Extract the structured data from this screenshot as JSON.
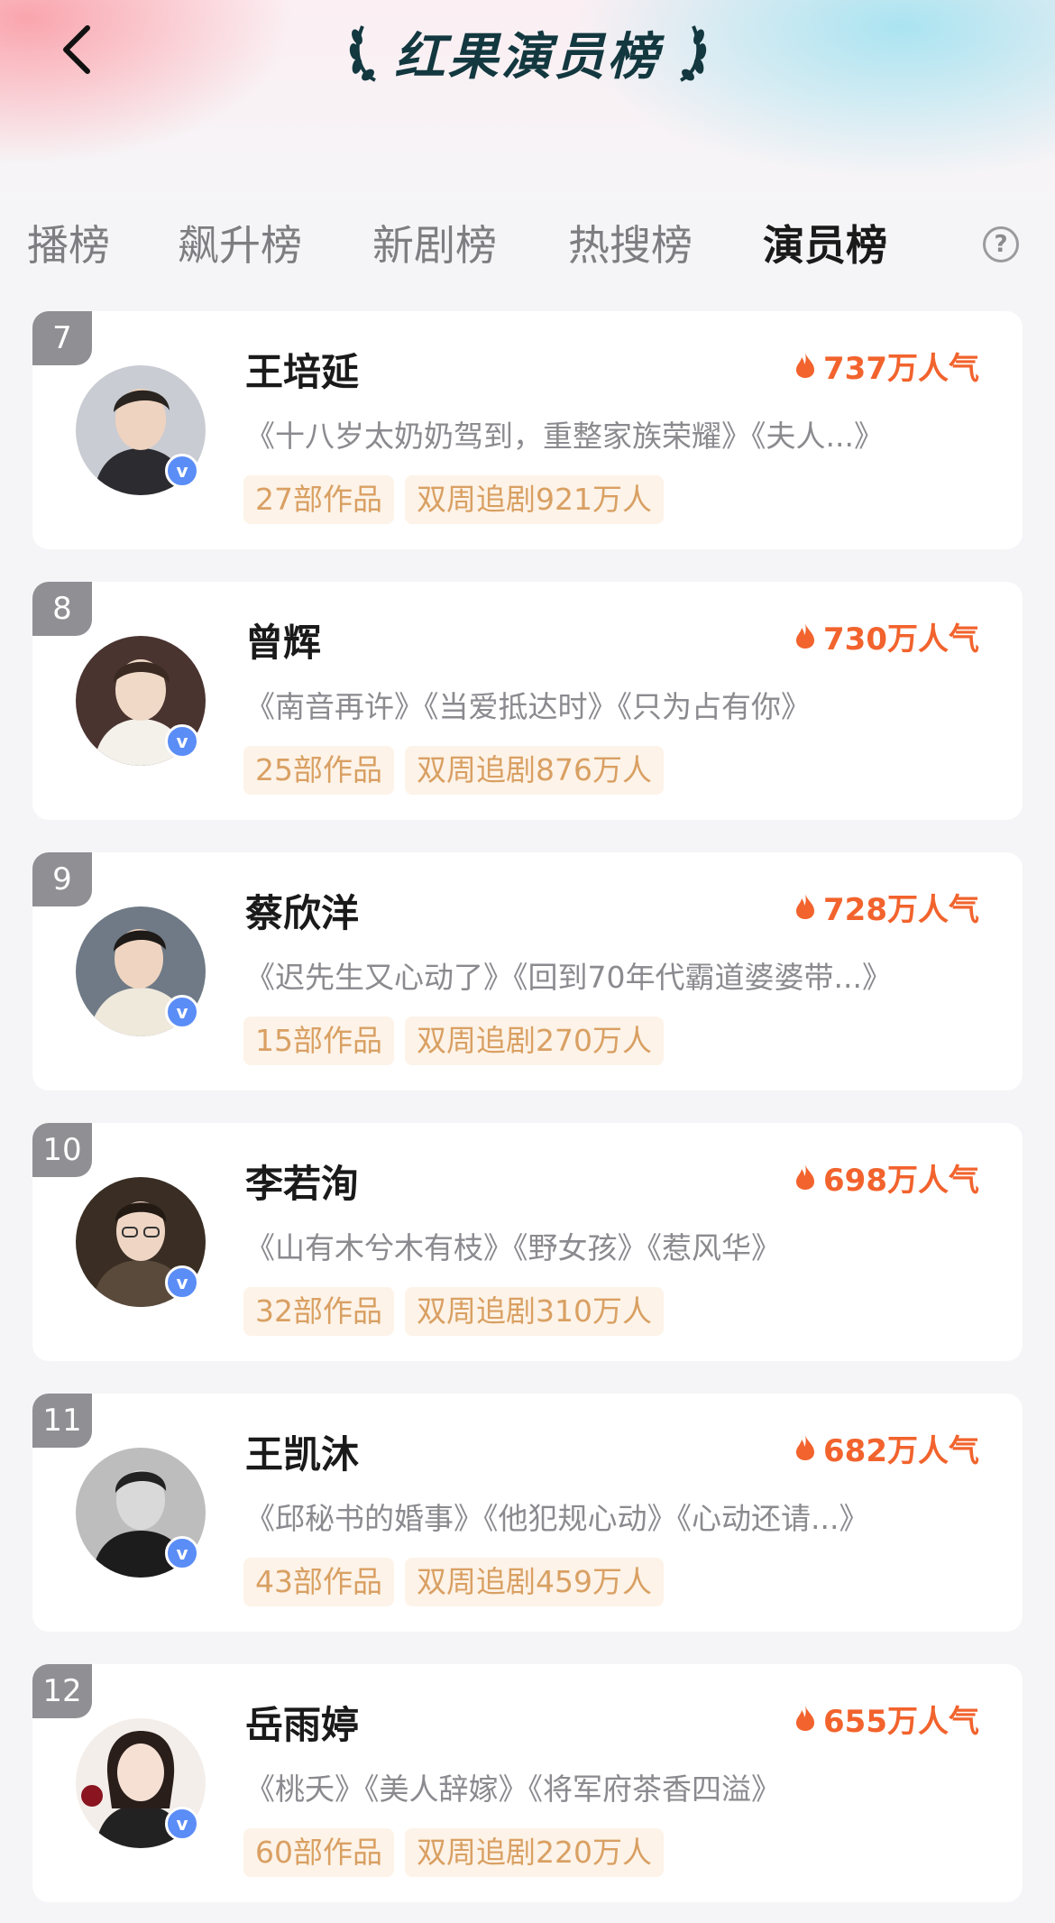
{
  "header": {
    "title": "红果演员榜",
    "back_icon": "chevron-left-icon"
  },
  "tabs": [
    {
      "label": "播榜",
      "active": false
    },
    {
      "label": "飙升榜",
      "active": false
    },
    {
      "label": "新剧榜",
      "active": false
    },
    {
      "label": "热搜榜",
      "active": false
    },
    {
      "label": "演员榜",
      "active": true
    }
  ],
  "help": {
    "icon": "question-circle-icon",
    "label": "?"
  },
  "colors": {
    "accent": "#f2632d",
    "title": "#13383f",
    "tag_text": "#d9a063",
    "tag_bg": "#fdf3e8",
    "verified": "#5b8df7",
    "rank_badge": "#8f8f94"
  },
  "verified_badge": "v",
  "actors": [
    {
      "rank": "7",
      "name": "王培延",
      "popularity": "737万人气",
      "works": "《十八岁太奶奶驾到，重整家族荣耀》《夫人...》",
      "count": "27部作品",
      "followers": "双周追剧921万人"
    },
    {
      "rank": "8",
      "name": "曾辉",
      "popularity": "730万人气",
      "works": "《南音再许》《当爱抵达时》《只为占有你》",
      "count": "25部作品",
      "followers": "双周追剧876万人"
    },
    {
      "rank": "9",
      "name": "蔡欣洋",
      "popularity": "728万人气",
      "works": "《迟先生又心动了》《回到70年代霸道婆婆带...》",
      "count": "15部作品",
      "followers": "双周追剧270万人"
    },
    {
      "rank": "10",
      "name": "李若洵",
      "popularity": "698万人气",
      "works": "《山有木兮木有枝》《野女孩》《惹风华》",
      "count": "32部作品",
      "followers": "双周追剧310万人"
    },
    {
      "rank": "11",
      "name": "王凯沐",
      "popularity": "682万人气",
      "works": "《邱秘书的婚事》《他犯规心动》《心动还请...》",
      "count": "43部作品",
      "followers": "双周追剧459万人"
    },
    {
      "rank": "12",
      "name": "岳雨婷",
      "popularity": "655万人气",
      "works": "《桃夭》《美人辞嫁》《将军府茶香四溢》",
      "count": "60部作品",
      "followers": "双周追剧220万人"
    }
  ]
}
